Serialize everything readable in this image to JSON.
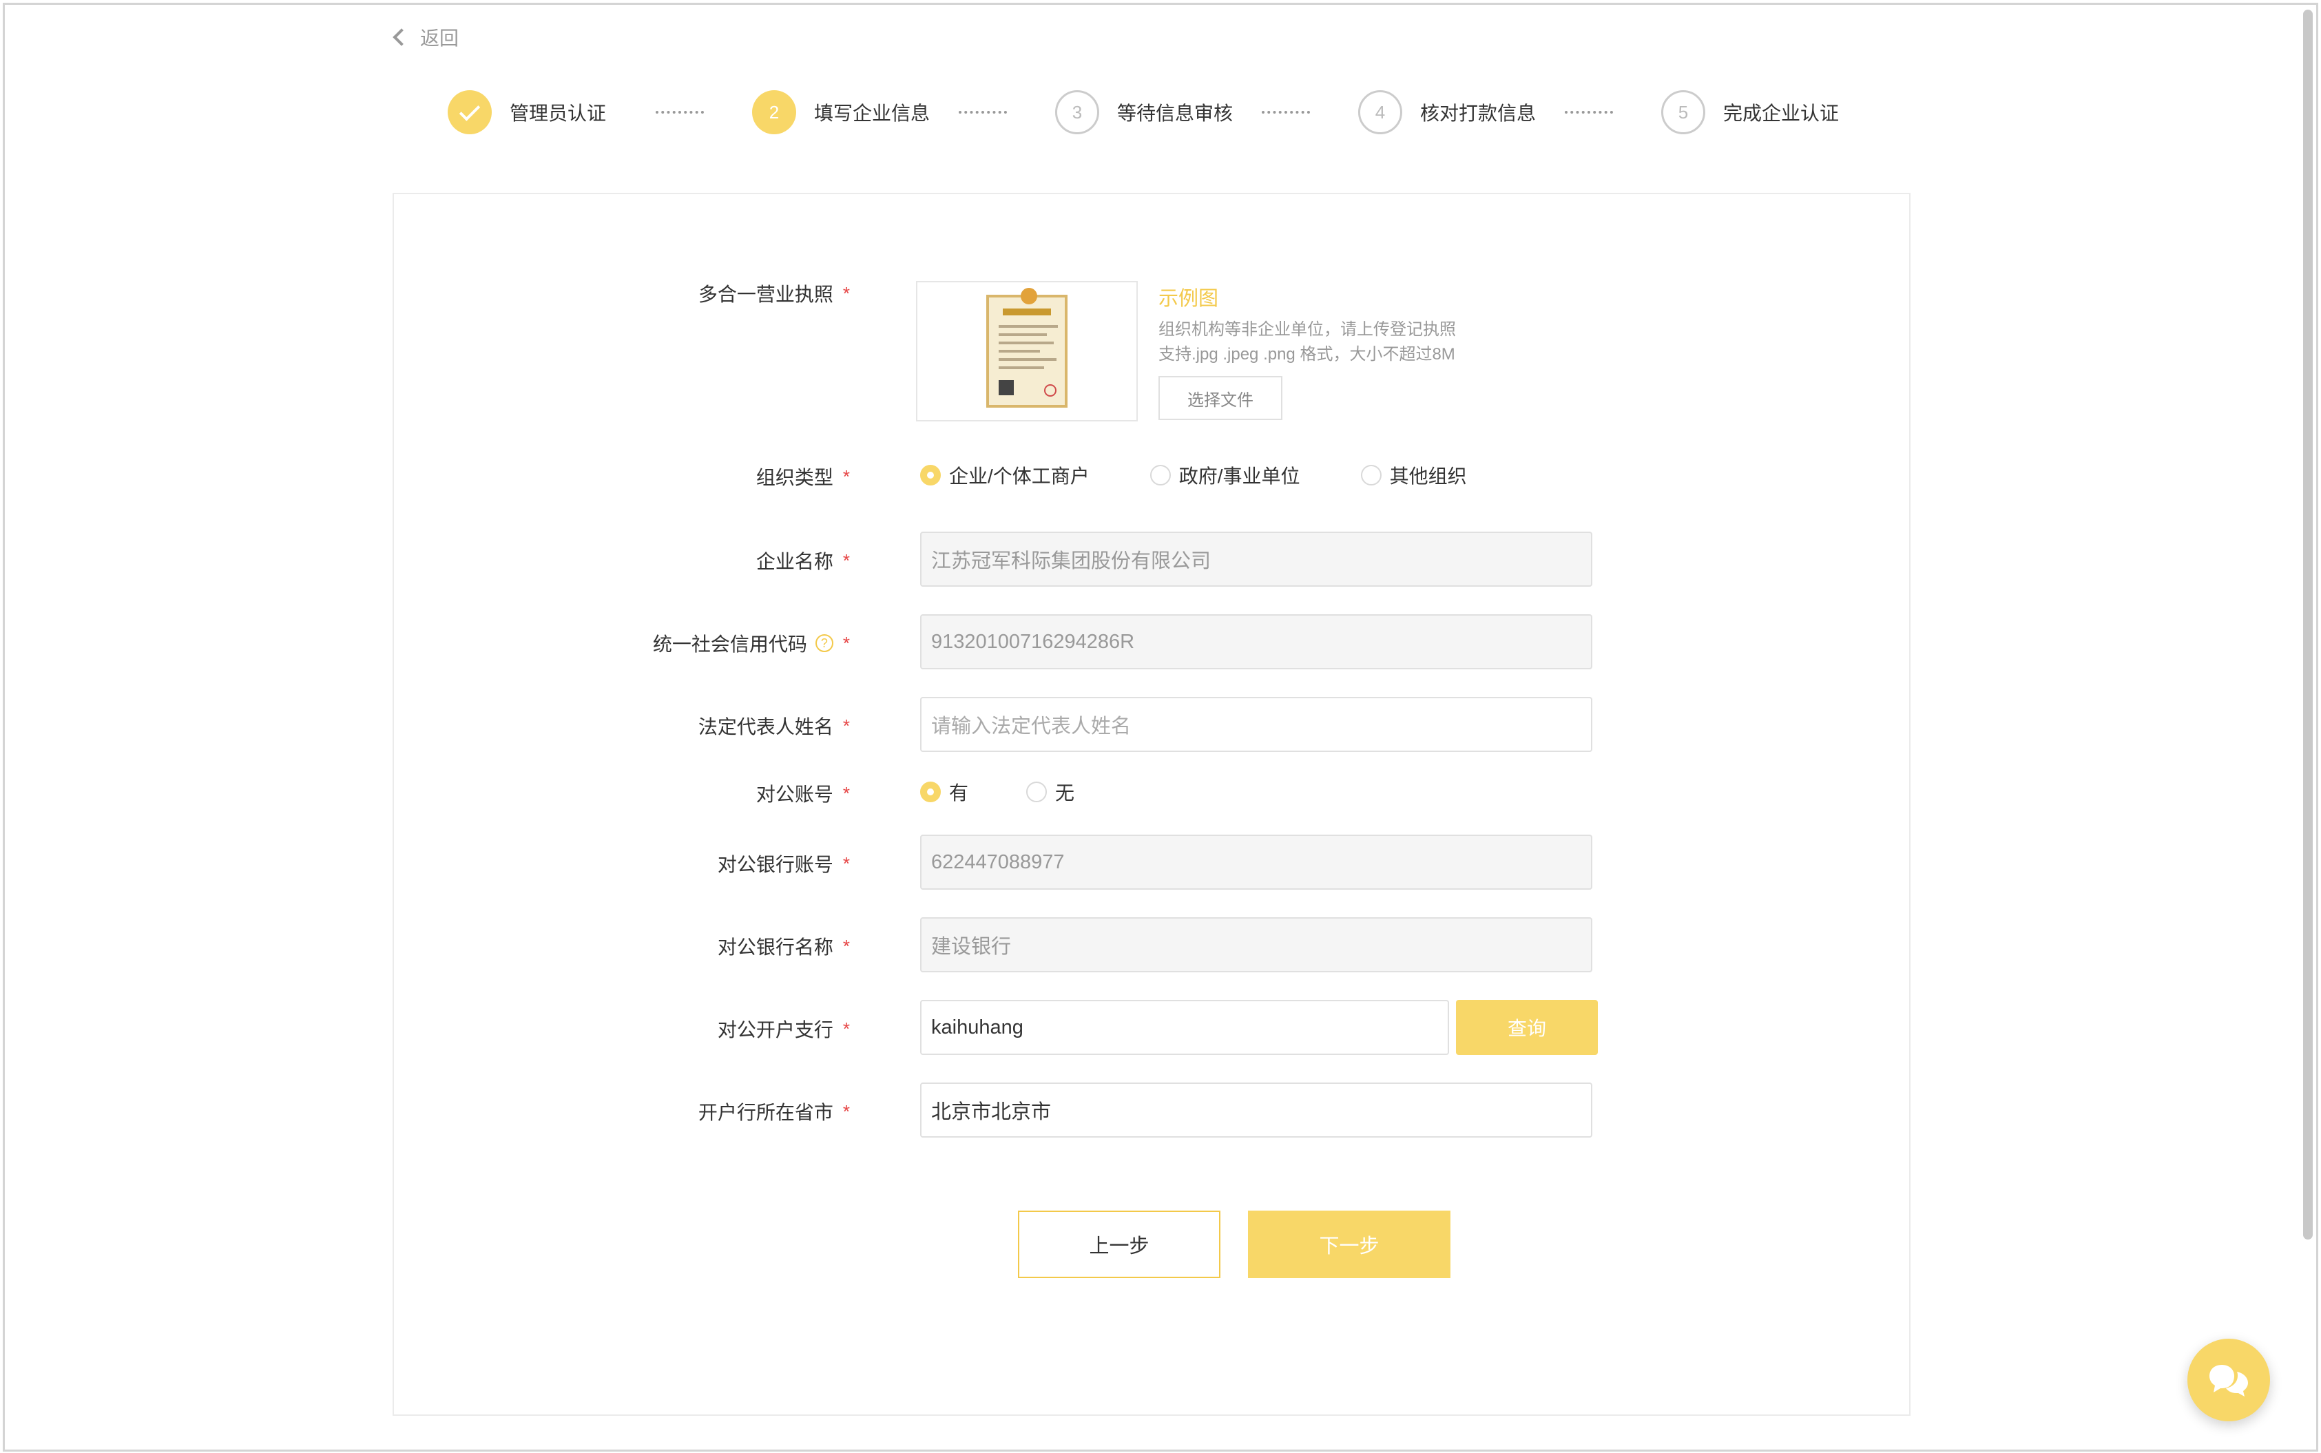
{
  "nav": {
    "back_label": "返回"
  },
  "steps": [
    {
      "number": "1",
      "label": "管理员认证",
      "state": "done"
    },
    {
      "number": "2",
      "label": "填写企业信息",
      "state": "active"
    },
    {
      "number": "3",
      "label": "等待信息审核",
      "state": "pending"
    },
    {
      "number": "4",
      "label": "核对打款信息",
      "state": "pending"
    },
    {
      "number": "5",
      "label": "完成企业认证",
      "state": "pending"
    }
  ],
  "form": {
    "license": {
      "label": "多合一营业执照",
      "example_link": "示例图",
      "hint_1": "组织机构等非企业单位，请上传登记执照",
      "hint_2": "支持.jpg .jpeg .png 格式，大小不超过8M",
      "choose_button": "选择文件"
    },
    "org_type": {
      "label": "组织类型",
      "options": [
        "企业/个体工商户",
        "政府/事业单位",
        "其他组织"
      ],
      "selected": "企业/个体工商户"
    },
    "company_name": {
      "label": "企业名称",
      "value": "江苏冠军科际集团股份有限公司"
    },
    "credit_code": {
      "label": "统一社会信用代码",
      "help_icon": "question-icon",
      "value": "91320100716294286R"
    },
    "legal_rep": {
      "label": "法定代表人姓名",
      "placeholder": "请输入法定代表人姓名"
    },
    "public_account": {
      "label": "对公账号",
      "options": [
        "有",
        "无"
      ],
      "selected": "有"
    },
    "bank_account": {
      "label": "对公银行账号",
      "value": "622447088977"
    },
    "bank_name": {
      "label": "对公银行名称",
      "value": "建设银行"
    },
    "bank_branch": {
      "label": "对公开户支行",
      "value": "kaihuhang",
      "query_button": "查询"
    },
    "bank_region": {
      "label": "开户行所在省市",
      "value": "北京市北京市"
    },
    "required_mark": "*",
    "prev_button": "上一步",
    "next_button": "下一步"
  },
  "colors": {
    "accent": "#f8d768",
    "required": "#e64545",
    "border": "#e0e0e0",
    "disabled_bg": "#f5f5f5"
  },
  "icons": {
    "back": "chevron-left-icon",
    "step_done": "check-icon",
    "chat": "chat-bubble-icon"
  }
}
